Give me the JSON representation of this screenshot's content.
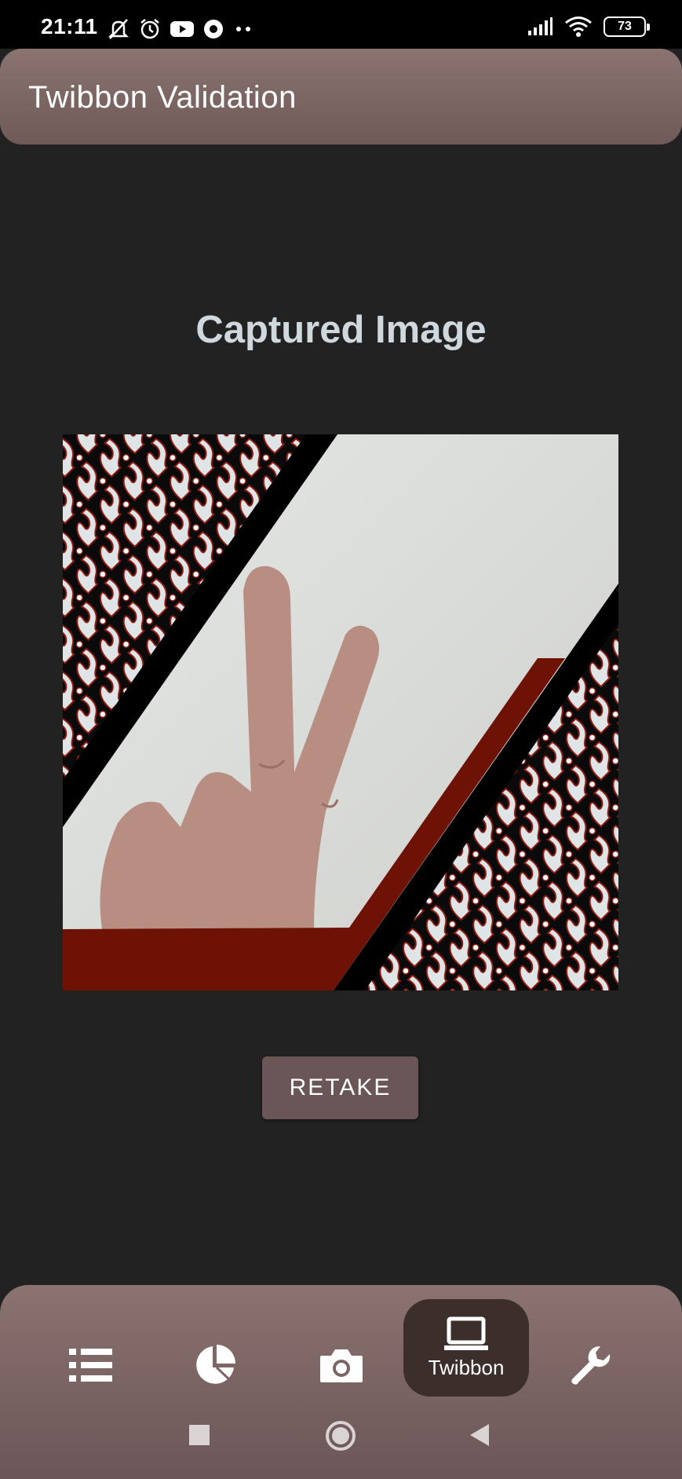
{
  "status_bar": {
    "time": "21:11",
    "battery": "73",
    "icons": [
      "mute-icon",
      "alarm-icon",
      "youtube-icon",
      "location-icon",
      "more-dots-icon",
      "signal-icon",
      "wifi-icon",
      "battery-icon"
    ]
  },
  "app_bar": {
    "title": "Twibbon Validation"
  },
  "main": {
    "heading": "Captured Image",
    "retake_label": "RETAKE"
  },
  "bottom_nav": {
    "items": [
      {
        "icon": "list-icon",
        "label": ""
      },
      {
        "icon": "pie-chart-icon",
        "label": ""
      },
      {
        "icon": "camera-icon",
        "label": ""
      },
      {
        "icon": "laptop-icon",
        "label": "Twibbon",
        "active": true
      },
      {
        "icon": "wrench-icon",
        "label": ""
      }
    ]
  },
  "system_nav": [
    "recents-button",
    "home-button",
    "back-button"
  ],
  "colors": {
    "background": "#222222",
    "app_bar": "#7b6563",
    "heading": "#cfd8dc",
    "retake_button": "#6b5657",
    "nav_active": "#3b2e2b",
    "twibbon_red": "#6e1206"
  }
}
